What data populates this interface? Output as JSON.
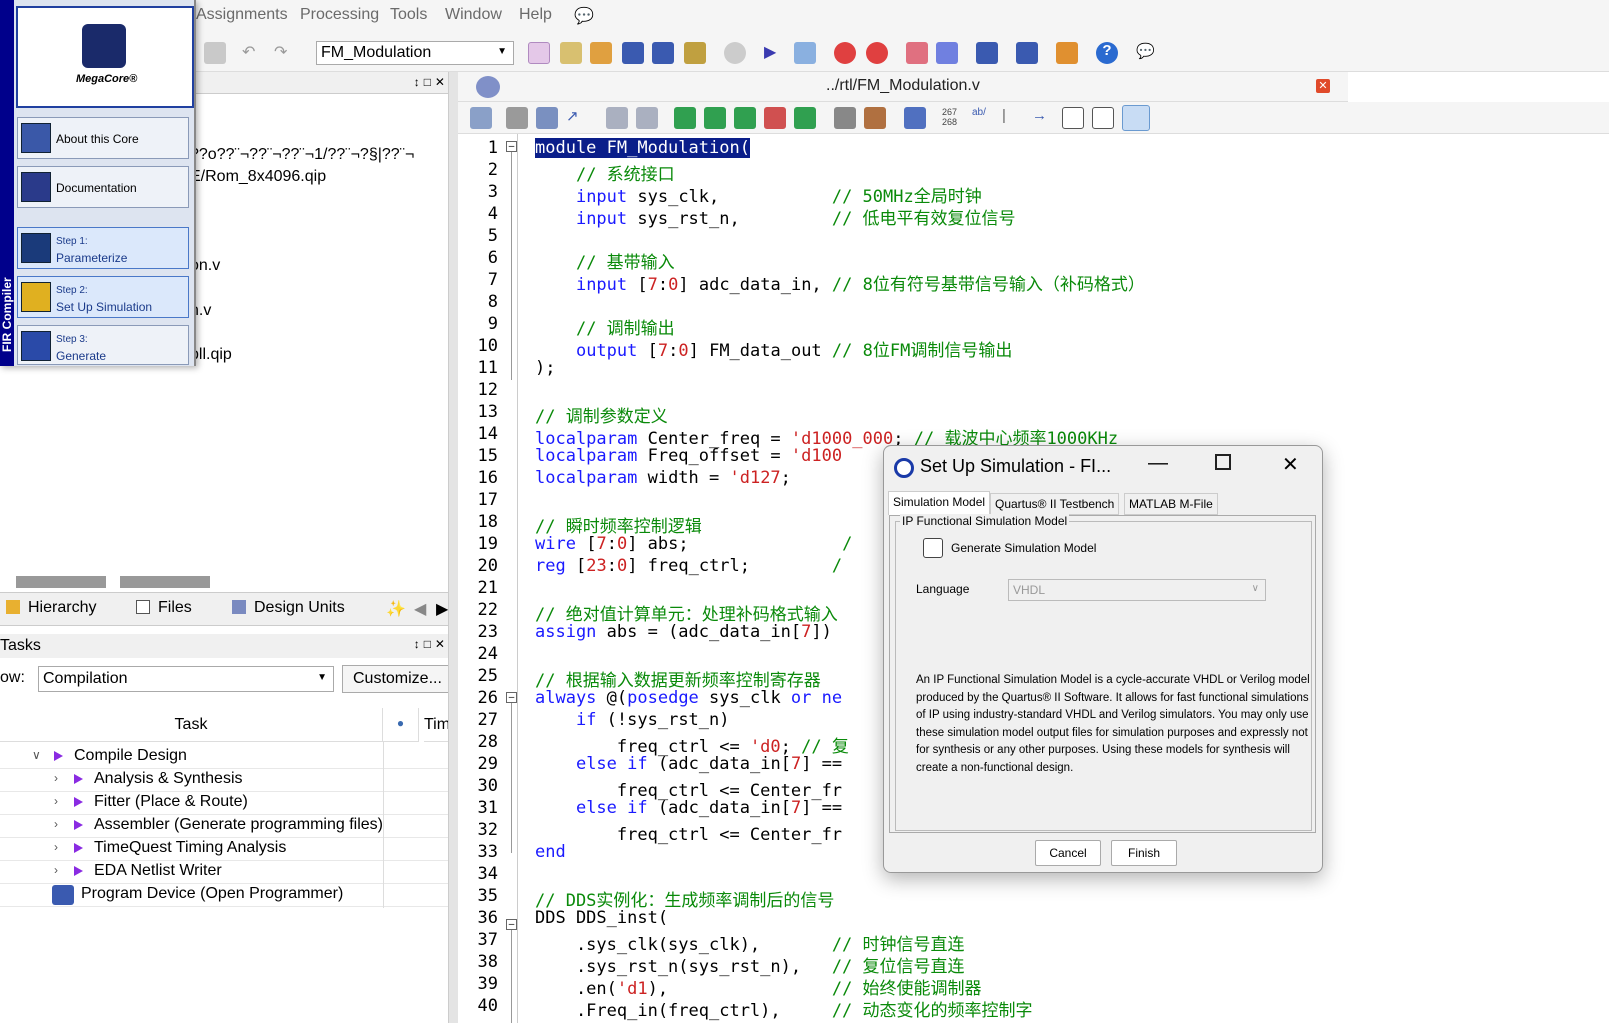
{
  "menubar": {
    "items": [
      "Assignments",
      "Processing",
      "Tools",
      "Window",
      "Help"
    ]
  },
  "toolbar": {
    "project": "FM_Modulation"
  },
  "file_list": {
    "garbled": "??o??¨¬??¨¬??¨¬1/??¨¬?§|??¨¬",
    "lines": [
      "E/Rom_8x4096.qip",
      "on.v",
      "n.v",
      "pll.qip"
    ]
  },
  "nav_tabs": [
    "Hierarchy",
    "Files",
    "Design Units"
  ],
  "tasks": {
    "title": "Tasks",
    "flow_label": "ow:",
    "flow_value": "Compilation",
    "customize": "Customize...",
    "col_task": "Task",
    "col_time": "Tim",
    "rows": [
      "Compile Design",
      "Analysis & Synthesis",
      "Fitter (Place & Route)",
      "Assembler (Generate programming files)",
      "TimeQuest Timing Analysis",
      "EDA Netlist Writer",
      "Program Device (Open Programmer)"
    ]
  },
  "editor": {
    "title": "../rtl/FM_Modulation.v",
    "line_numbers": [
      "1",
      "2",
      "3",
      "4",
      "5",
      "6",
      "7",
      "8",
      "9",
      "10",
      "11",
      "12",
      "13",
      "14",
      "15",
      "16",
      "17",
      "18",
      "19",
      "20",
      "21",
      "22",
      "23",
      "24",
      "25",
      "26",
      "27",
      "28",
      "29",
      "30",
      "31",
      "32",
      "33",
      "34",
      "35",
      "36",
      "37",
      "38",
      "39",
      "40"
    ]
  },
  "megacore": {
    "side_label": "FIR Compiler",
    "logo": "MegaCore®",
    "about": "About this Core",
    "doc": "Documentation",
    "step1_a": "Step 1:",
    "step1_b": "Parameterize",
    "step2_a": "Step 2:",
    "step2_b": "Set Up Simulation",
    "step3_a": "Step 3:",
    "step3_b": "Generate"
  },
  "dialog": {
    "title": "Set Up Simulation - FI...",
    "tab1": "Simulation Model",
    "tab2": "Quartus® II Testbench",
    "tab3": "MATLAB M-File",
    "group": "IP Functional Simulation Model",
    "checkbox": "Generate Simulation Model",
    "language_label": "Language",
    "language_value": "VHDL",
    "description": "An IP Functional Simulation Model is a cycle-accurate VHDL or Verilog model produced by the Quartus® II Software. It allows for fast functional simulations of IP using industry-standard VHDL and Verilog simulators. You may only use these simulation model output files for simulation purposes and expressly not for synthesis or any other purposes. Using these models for synthesis will create a non-functional design.",
    "cancel": "Cancel",
    "finish": "Finish"
  }
}
